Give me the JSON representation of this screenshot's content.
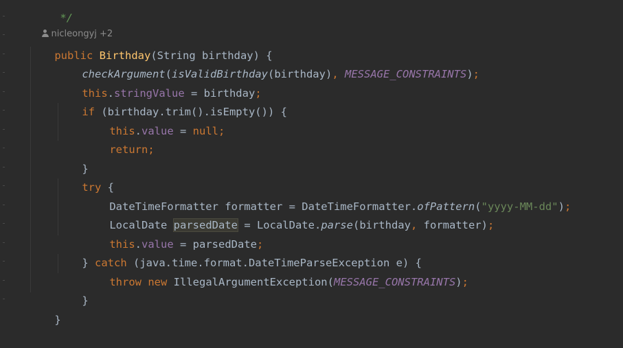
{
  "code": {
    "top_comment": "*/",
    "author_hint": "nicleongyj +2",
    "tokens": {
      "public": "public",
      "ctor_name": "Birthday",
      "param_open": "(String birthday) {",
      "checkArgument": "checkArgument",
      "isValidBirthday": "isValidBirthday",
      "birthday_arg": "(birthday)",
      "comma": ",",
      "message_constraints": "MESSAGE_CONSTRAINTS",
      "close_paren_semi": ");",
      "this": "this",
      "dot": ".",
      "stringValue": "stringValue",
      "assign_birthday": " = birthday",
      "semi": ";",
      "if": "if",
      "if_cond": " (birthday.trim().isEmpty()) {",
      "value": "value",
      "assign": " = ",
      "null": "null",
      "return": "return",
      "close_brace": "}",
      "try": "try",
      "open_brace": " {",
      "dtf_decl": "DateTimeFormatter formatter = DateTimeFormatter.",
      "ofPattern": "ofPattern",
      "open_paren": "(",
      "pattern": "\"yyyy-MM-dd\"",
      "localdate_type": "LocalDate ",
      "parsedDate": "parsedDate",
      "ld_parse_prefix": " = LocalDate.",
      "parse": "parse",
      "parse_args_a": "(birthday",
      "parse_args_b": " formatter)",
      "assign_parsed": " = parsedDate",
      "close_brace_sp": "} ",
      "catch": "catch",
      "catch_cond": " (java.time.format.DateTimeParseException e) {",
      "throw": "throw",
      "new": "new",
      "iae": " IllegalArgumentException(",
      "close_paren": ")"
    }
  }
}
